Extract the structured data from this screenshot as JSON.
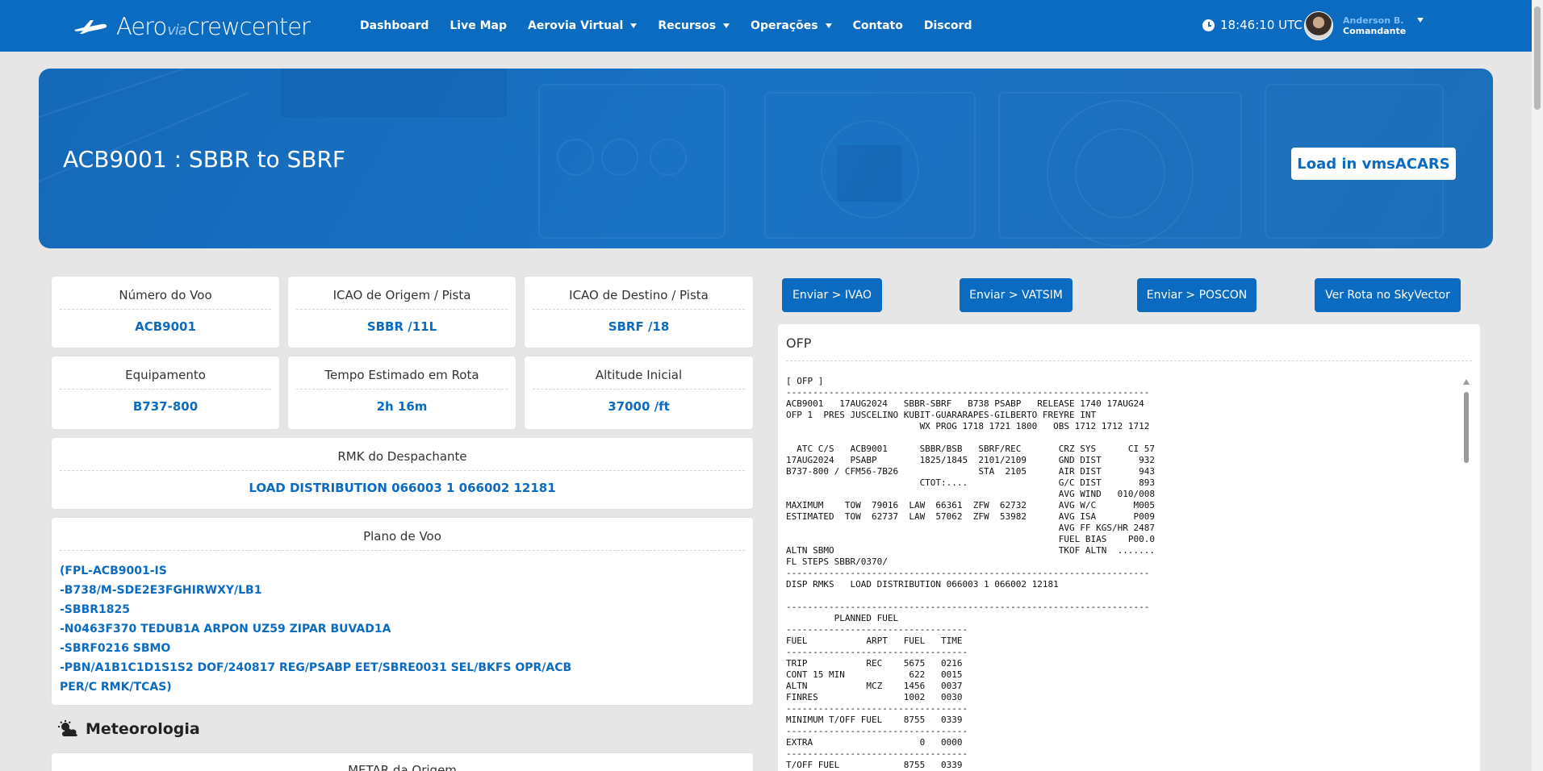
{
  "brand": {
    "part1": "Aero",
    "part2": "via",
    "part3": "crewcenter"
  },
  "nav": {
    "items": [
      {
        "label": "Dashboard",
        "dropdown": false
      },
      {
        "label": "Live Map",
        "dropdown": false
      },
      {
        "label": "Aerovia Virtual",
        "dropdown": true
      },
      {
        "label": "Recursos",
        "dropdown": true
      },
      {
        "label": "Operações",
        "dropdown": true
      },
      {
        "label": "Contato",
        "dropdown": false
      },
      {
        "label": "Discord",
        "dropdown": false
      }
    ],
    "time": "18:46:10 UTC",
    "user": {
      "name": "Anderson B.",
      "role": "Comandante"
    }
  },
  "hero": {
    "title": "ACB9001 : SBBR to SBRF",
    "button": "Load in vmsACARS"
  },
  "flight": {
    "number": {
      "label": "Número do Voo",
      "value": "ACB9001"
    },
    "origin": {
      "label": "ICAO de Origem / Pista",
      "value": "SBBR /11L"
    },
    "destination": {
      "label": "ICAO de Destino / Pista",
      "value": "SBRF /18"
    },
    "equipment": {
      "label": "Equipamento",
      "value": "B737-800"
    },
    "ete": {
      "label": "Tempo Estimado em Rota",
      "value": "2h 16m"
    },
    "altitude": {
      "label": "Altitude Inicial",
      "value": "37000 /ft"
    },
    "rmk": {
      "label": "RMK do Despachante",
      "value": "LOAD DISTRIBUTION 066003 1 066002 12181"
    },
    "plan": {
      "label": "Plano de Voo",
      "lines": [
        "(FPL-ACB9001-IS",
        "-B738/M-SDE2E3FGHIRWXY/LB1",
        "-SBBR1825",
        "-N0463F370 TEDUB1A ARPON UZ59 ZIPAR BUVAD1A",
        "-SBRF0216 SBMO",
        "-PBN/A1B1C1D1S1S2 DOF/240817 REG/PSABP EET/SBRE0031 SEL/BKFS OPR/ACB",
        "PER/C RMK/TCAS)"
      ]
    }
  },
  "weather": {
    "title": "Meteorologia",
    "metar_origin_label": "METAR da Origem"
  },
  "actions": {
    "ivao": "Enviar > IVAO",
    "vatsim": "Enviar > VATSIM",
    "poscon": "Enviar > POSCON",
    "skyvector": "Ver Rota no SkyVector"
  },
  "ofp": {
    "title": "OFP",
    "text": "[ OFP ]\n--------------------------------------------------------------------\nACB9001   17AUG2024   SBBR-SBRF   B738 PSABP   RELEASE 1740 17AUG24\nOFP 1  PRES JUSCELINO KUBIT-GUARARAPES-GILBERTO FREYRE INT\n                         WX PROG 1718 1721 1800   OBS 1712 1712 1712\n\n  ATC C/S   ACB9001      SBBR/BSB   SBRF/REC       CRZ SYS      CI 57\n17AUG2024   PSABP        1825/1845  2101/2109      GND DIST       932\nB737-800 / CFM56-7B26               STA  2105      AIR DIST       943\n                         CTOT:....                 G/C DIST       893\n                                                   AVG WIND   010/008\nMAXIMUM    TOW  79016  LAW  66361  ZFW  62732      AVG W/C       M005\nESTIMATED  TOW  62737  LAW  57062  ZFW  53982      AVG ISA       P009\n                                                   AVG FF KGS/HR 2487\n                                                   FUEL BIAS    P00.0\nALTN SBMO                                          TKOF ALTN  .......\nFL STEPS SBBR/0370/\n--------------------------------------------------------------------\nDISP RMKS   LOAD DISTRIBUTION 066003 1 066002 12181\n\n--------------------------------------------------------------------\n         PLANNED FUEL\n----------------------------------\nFUEL           ARPT   FUEL   TIME\n----------------------------------\nTRIP           REC    5675   0216\nCONT 15 MIN            622   0015\nALTN           MCZ    1456   0037\nFINRES                1002   0030\n----------------------------------\nMINIMUM T/OFF FUEL    8755   0339\n----------------------------------\nEXTRA                    0   0000\n----------------------------------\nT/OFF FUEL            8755   0339"
  }
}
